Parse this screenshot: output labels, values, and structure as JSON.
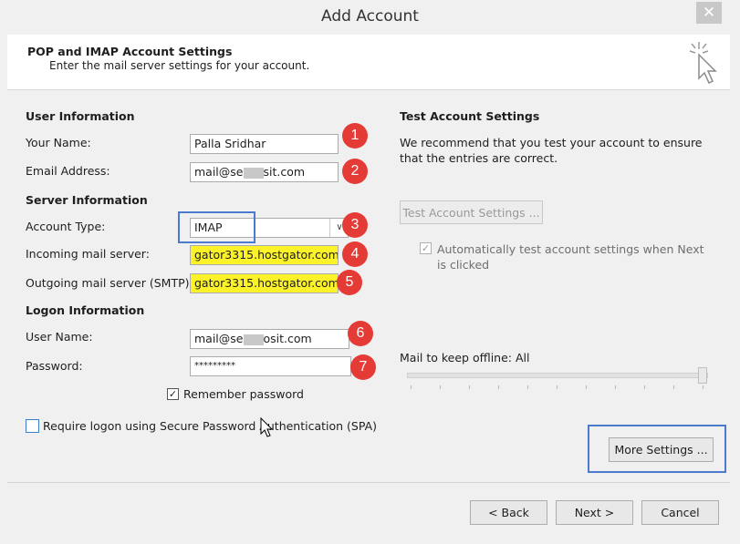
{
  "window": {
    "title": "Add Account",
    "close_glyph": "✕"
  },
  "header": {
    "title": "POP and IMAP Account Settings",
    "subtitle": "Enter the mail server settings for your account."
  },
  "user_info": {
    "section": "User Information",
    "name_label": "Your Name:",
    "name_value": "Palla Sridhar",
    "email_label": "Email Address:",
    "email_prefix": "mail@se",
    "email_suffix": "sit.com"
  },
  "server_info": {
    "section": "Server Information",
    "account_type_label": "Account Type:",
    "account_type_value": "IMAP",
    "incoming_label": "Incoming mail server:",
    "incoming_value": "gator3315.hostgator.com",
    "outgoing_label": "Outgoing mail server (SMTP):",
    "outgoing_value": "gator3315.hostgator.com"
  },
  "logon_info": {
    "section": "Logon Information",
    "username_label": "User Name:",
    "username_prefix": "mail@se",
    "username_suffix": "osit.com",
    "password_label": "Password:",
    "password_value": "*********",
    "remember_label": "Remember password",
    "remember_checked": true,
    "spa_label": "Require logon using Secure Password Authentication (SPA)",
    "spa_checked": false
  },
  "test_settings": {
    "section": "Test Account Settings",
    "description": "We recommend that you test your account to ensure that the entries are correct.",
    "test_button": "Test Account Settings ...",
    "auto_test_label": "Automatically test account settings when Next is clicked",
    "auto_test_checked": true
  },
  "offline": {
    "label": "Mail to keep offline:",
    "value": "All",
    "slider_level_percent": 100
  },
  "buttons": {
    "more_settings": "More Settings ...",
    "back": "< Back",
    "next": "Next >",
    "cancel": "Cancel"
  },
  "badges": [
    "1",
    "2",
    "3",
    "4",
    "5",
    "6",
    "7"
  ],
  "colors": {
    "badge": "#e53b36",
    "highlight": "#fbf22a",
    "annotation_box": "#4a7bd0"
  }
}
